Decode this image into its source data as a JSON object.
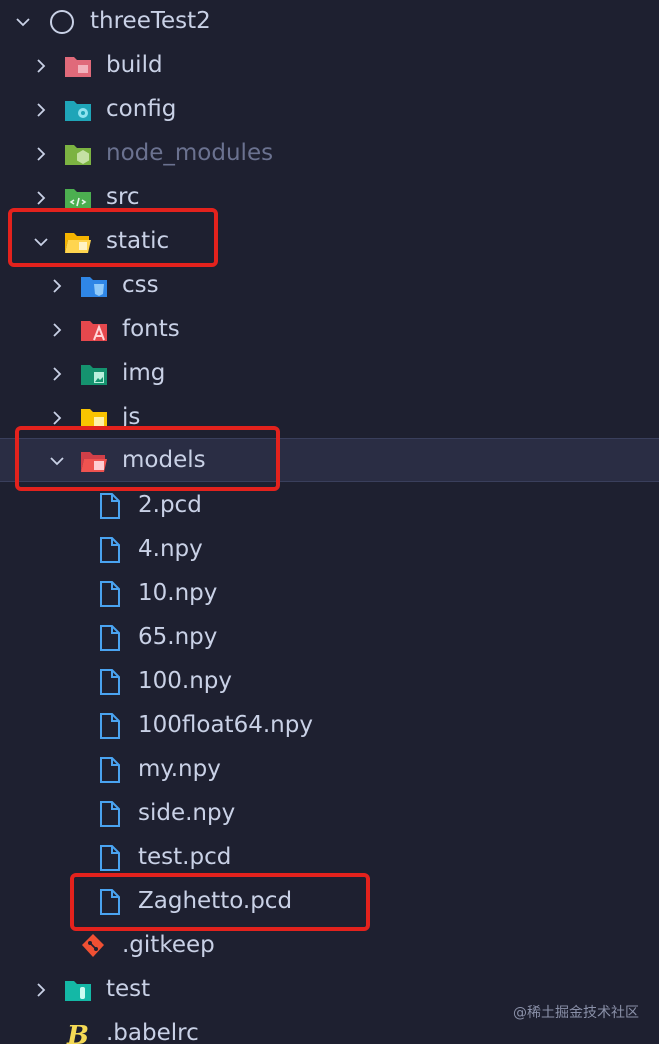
{
  "explorer": {
    "root": {
      "label": "threeTest2"
    },
    "items": [
      {
        "label": "build"
      },
      {
        "label": "config"
      },
      {
        "label": "node_modules"
      },
      {
        "label": "src"
      },
      {
        "label": "static"
      },
      {
        "label": "css"
      },
      {
        "label": "fonts"
      },
      {
        "label": "img"
      },
      {
        "label": "js"
      },
      {
        "label": "models"
      },
      {
        "label": "2.pcd"
      },
      {
        "label": "4.npy"
      },
      {
        "label": "10.npy"
      },
      {
        "label": "65.npy"
      },
      {
        "label": "100.npy"
      },
      {
        "label": "100float64.npy"
      },
      {
        "label": "my.npy"
      },
      {
        "label": "side.npy"
      },
      {
        "label": "test.pcd"
      },
      {
        "label": "Zaghetto.pcd"
      },
      {
        "label": ".gitkeep"
      },
      {
        "label": "test"
      },
      {
        "label": ".babelrc"
      }
    ]
  },
  "watermark": "@稀土掘金技术社区",
  "colors": {
    "background": "#1e2030",
    "text": "#c9d1e6",
    "highlight": "#e3221d",
    "file_icon": "#4aa3f0"
  }
}
